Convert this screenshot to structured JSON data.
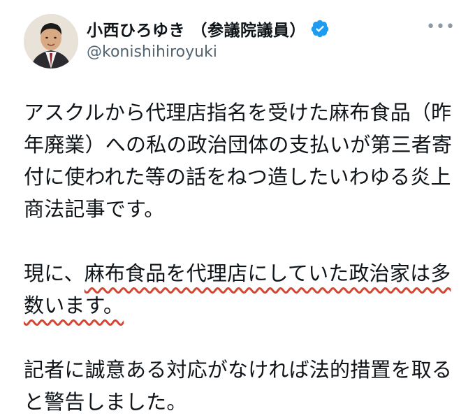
{
  "author": {
    "display_name": "小西ひろゆき （参議院議員）",
    "handle": "@konishihiroyuki",
    "verified": true,
    "verified_icon": "verified-badge-icon",
    "avatar_icon": "profile-photo"
  },
  "more_menu": {
    "label": "•••",
    "icon": "more-options-icon"
  },
  "tweet": {
    "p1": "アスクルから代理店指名を受けた麻布食品（昨年廃業）への私の政治団体の支払いが第三者寄付に使われた等の話をねつ造したいわゆる炎上商法記事です。",
    "p2_pre": "現に、",
    "p2_underlined": "麻布食品を代理店にしていた政治家は多数います。",
    "p3": "記者に誠意ある対応がなければ法的措置を取ると警告しました。"
  },
  "colors": {
    "text": "#0f1419",
    "secondary": "#536471",
    "verified": "#1d9bf0",
    "underline": "#d6452f"
  }
}
